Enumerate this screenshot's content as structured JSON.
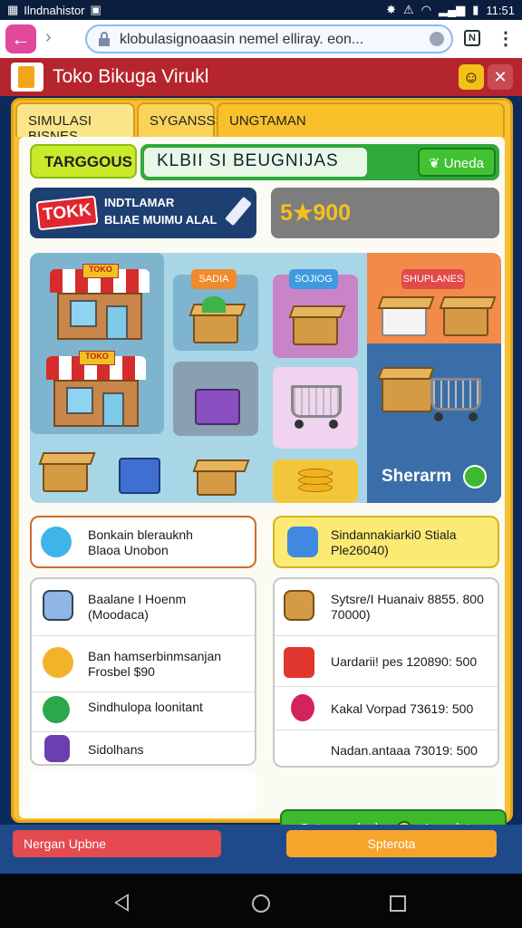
{
  "status": {
    "left_text": "Ilndnahistor",
    "time": "11:51"
  },
  "browser": {
    "url": "klobulasignoaasin nemel elliray. eon..."
  },
  "app": {
    "title": "Toko Bikuga Virukl"
  },
  "tabs": [
    {
      "label": "SIMULASI BISNES"
    },
    {
      "label": "SYGANSSS"
    },
    {
      "label": "UNGTAMAN"
    }
  ],
  "topbar": {
    "tag_label": "TARGGOUS",
    "progress_text": "KLBII SI BEUGNIJAS",
    "progress_value": 0.62,
    "update_label": "Uneda"
  },
  "banner": {
    "badge": "TOKK",
    "line1": "INDTLAMAR",
    "line2": "BLIAE MUIMU ALAL"
  },
  "score": {
    "value": "5★900"
  },
  "scene": {
    "tags": [
      "SADIA",
      "SOJIOG",
      "SHUPLANES"
    ],
    "sherarm_label": "Sherarm"
  },
  "cards": {
    "left": {
      "line1": "Bonkain blerauknh",
      "line2": "Blaoa Unobon"
    },
    "right": {
      "line1": "Sindannakiarki0 Stiala",
      "line2": "Ple26040)"
    }
  },
  "left_list": [
    {
      "line1": "Baalane I Hoenm",
      "line2": "(Moodaca)"
    },
    {
      "line1": "Ban hamserbinmsanjan",
      "line2": "Frosbel $90"
    },
    {
      "line1": "Sindhulopa loonitant",
      "line2": ""
    },
    {
      "line1": "Sidolhans",
      "line2": ""
    }
  ],
  "right_list": [
    {
      "line1": "Sytsre/I Huanaiv 8855. 800",
      "line2": "70000)"
    },
    {
      "line1": "Uardarii! pes 120890: 500",
      "line2": ""
    },
    {
      "line1": "Kakal Vorpad 73619: 500",
      "line2": ""
    },
    {
      "line1": "Nadan.antaaa 73019: 500",
      "line2": ""
    }
  ],
  "green_button": {
    "left": "Seteum cloch",
    "right": "Ipparlates"
  },
  "bottom_buttons": {
    "left": "Nergan Upbne",
    "right": "Spterota"
  },
  "colors": {
    "header_red": "#b5252d",
    "panel_yellow": "#f7c232",
    "green": "#3fba2e"
  }
}
